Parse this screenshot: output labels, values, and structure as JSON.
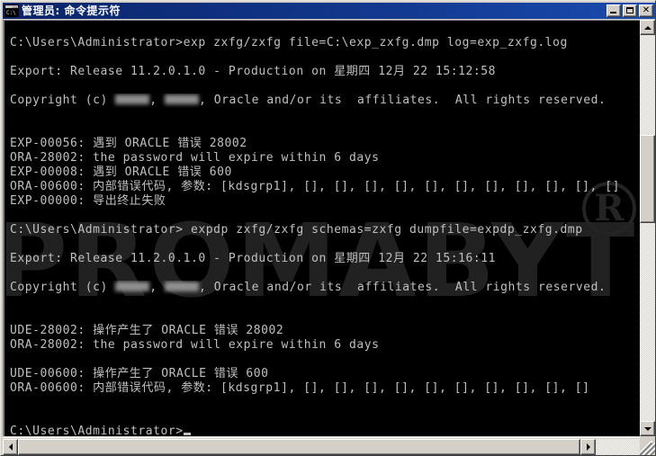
{
  "window": {
    "title": "管理员:  命令提示符",
    "icon_name": "console-icon",
    "icon_text": "C:\\",
    "buttons": {
      "minimize": "–",
      "maximize": "□",
      "close": "✕"
    }
  },
  "console": {
    "watermark_text": "PROMABYTE",
    "watermark_mark": "R",
    "lines": [
      {
        "type": "blank",
        "text": ""
      },
      {
        "type": "text",
        "text": "C:\\Users\\Administrator>exp zxfg/zxfg file=C:\\exp_zxfg.dmp log=exp_zxfg.log"
      },
      {
        "type": "blank",
        "text": ""
      },
      {
        "type": "text",
        "text": "Export: Release 11.2.0.1.0 - Production on 星期四 12月 22 15:12:58"
      },
      {
        "type": "blank",
        "text": ""
      },
      {
        "type": "censored",
        "prefix": "Copyright (c) ",
        "middle": ", ",
        "suffix": ", Oracle and/or its  affiliates.  All rights reserved."
      },
      {
        "type": "blank",
        "text": ""
      },
      {
        "type": "blank",
        "text": ""
      },
      {
        "type": "text",
        "text": "EXP-00056: 遇到 ORACLE 错误 28002"
      },
      {
        "type": "text",
        "text": "ORA-28002: the password will expire within 6 days"
      },
      {
        "type": "text",
        "text": "EXP-00008: 遇到 ORACLE 错误 600"
      },
      {
        "type": "text",
        "text": "ORA-00600: 内部错误代码, 参数: [kdsgrp1], [], [], [], [], [], [], [], [], [], [], []"
      },
      {
        "type": "text",
        "text": "EXP-00000: 导出终止失败"
      },
      {
        "type": "blank",
        "text": ""
      },
      {
        "type": "text",
        "text": "C:\\Users\\Administrator> expdp zxfg/zxfg schemas=zxfg dumpfile=expdp_zxfg.dmp"
      },
      {
        "type": "blank",
        "text": ""
      },
      {
        "type": "text",
        "text": "Export: Release 11.2.0.1.0 - Production on 星期四 12月 22 15:16:11"
      },
      {
        "type": "blank",
        "text": ""
      },
      {
        "type": "censored",
        "prefix": "Copyright (c) ",
        "middle": ", ",
        "suffix": ", Oracle and/or its  affiliates.  All rights reserved."
      },
      {
        "type": "blank",
        "text": ""
      },
      {
        "type": "blank",
        "text": ""
      },
      {
        "type": "text",
        "text": "UDE-28002: 操作产生了 ORACLE 错误 28002"
      },
      {
        "type": "text",
        "text": "ORA-28002: the password will expire within 6 days"
      },
      {
        "type": "blank",
        "text": ""
      },
      {
        "type": "text",
        "text": "UDE-00600: 操作产生了 ORACLE 错误 600"
      },
      {
        "type": "text",
        "text": "ORA-00600: 内部错误代码, 参数: [kdsgrp1], [], [], [], [], [], [], [], [], [], []"
      },
      {
        "type": "blank",
        "text": ""
      },
      {
        "type": "blank",
        "text": ""
      },
      {
        "type": "prompt",
        "text": "C:\\Users\\Administrator>"
      }
    ]
  },
  "scrollbars": {
    "vertical": {
      "up_arrow": "scroll-up-arrow",
      "down_arrow": "scroll-down-arrow"
    },
    "horizontal": {
      "left_arrow": "scroll-left-arrow",
      "right_arrow": "scroll-right-arrow"
    }
  }
}
